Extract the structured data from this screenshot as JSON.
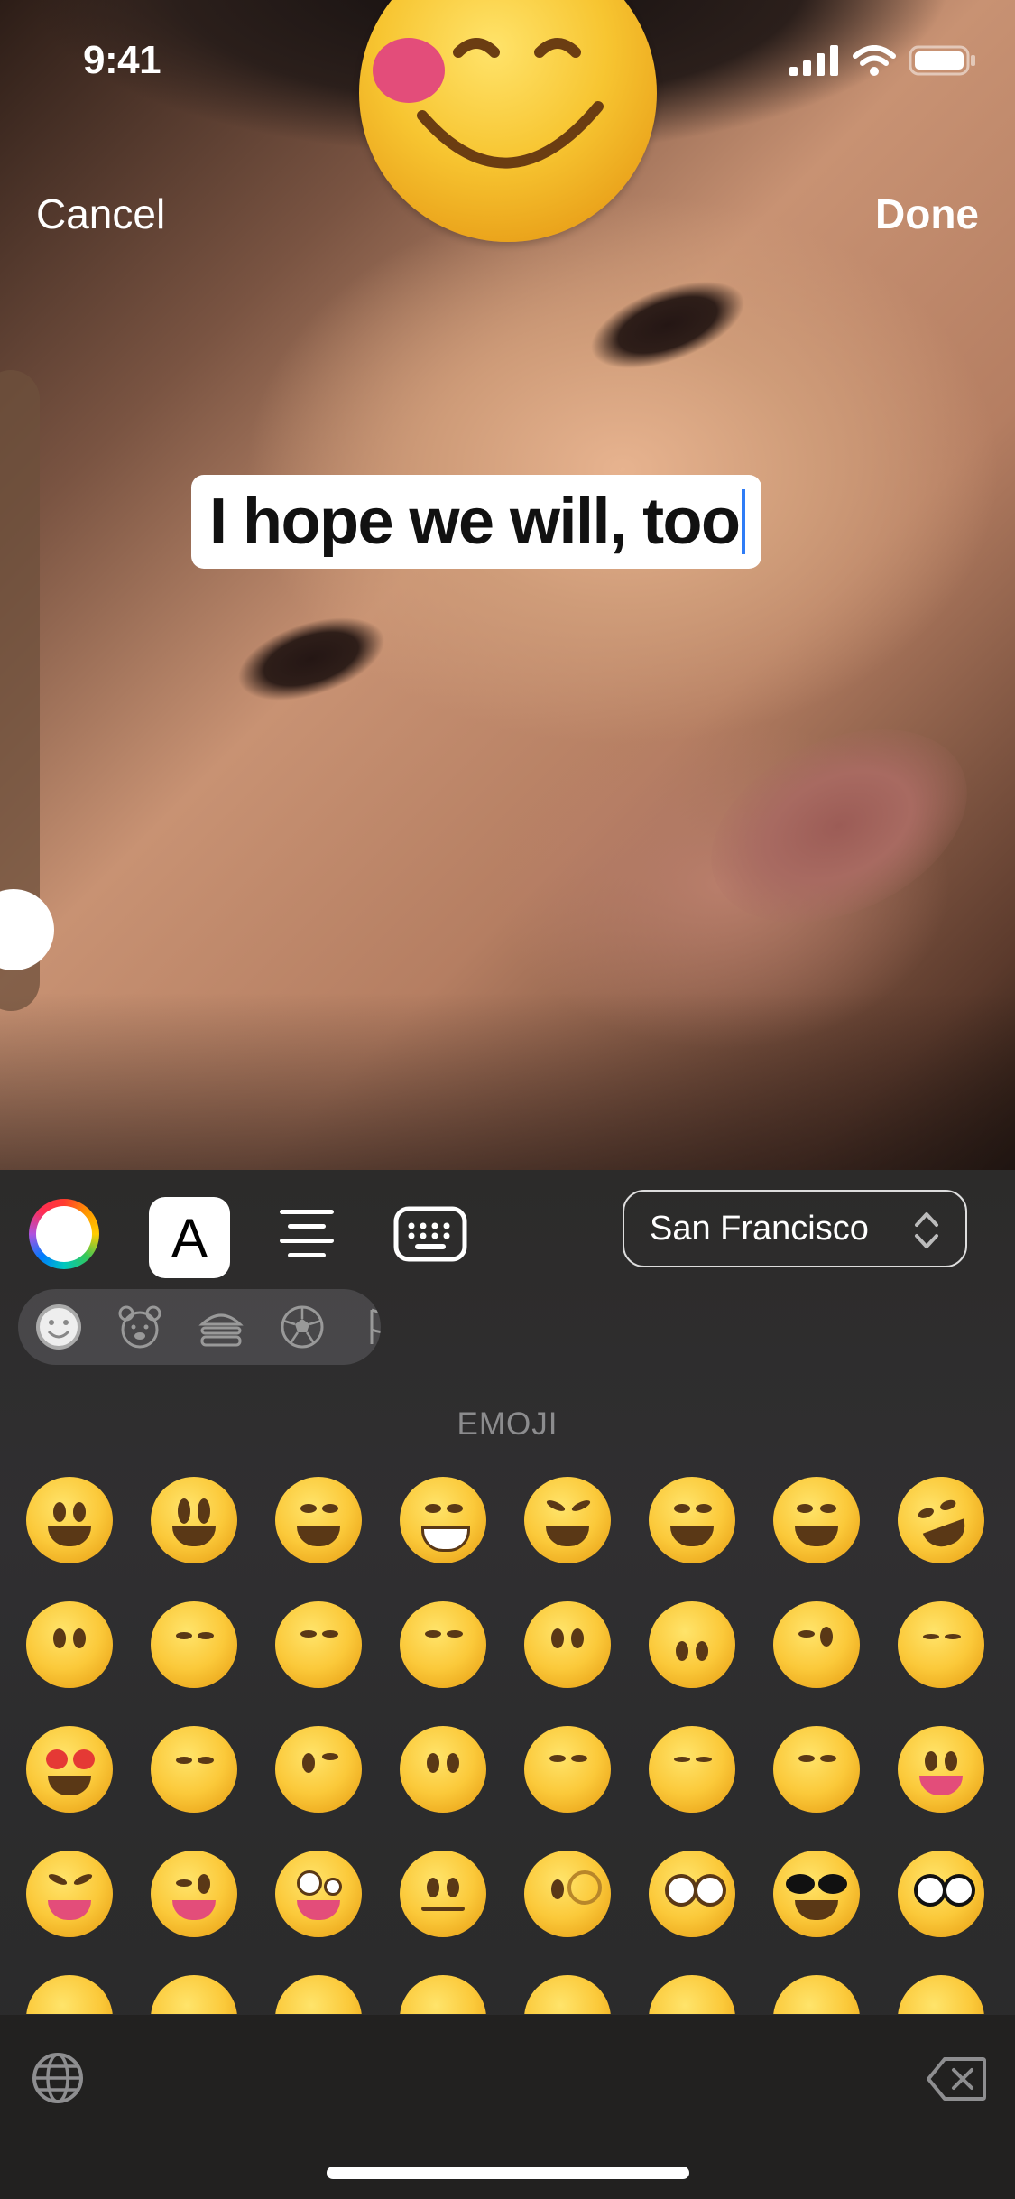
{
  "status_bar": {
    "time": "9:41"
  },
  "nav": {
    "cancel_label": "Cancel",
    "done_label": "Done"
  },
  "text_overlay": {
    "value": "I hope we will, too"
  },
  "toolbar": {
    "style_label": "A",
    "font_name": "San Francisco"
  },
  "emoji_section": {
    "header": "EMOJI"
  },
  "colors": {
    "caret": "#2f7cf6",
    "panel": "#2c2b2a"
  }
}
